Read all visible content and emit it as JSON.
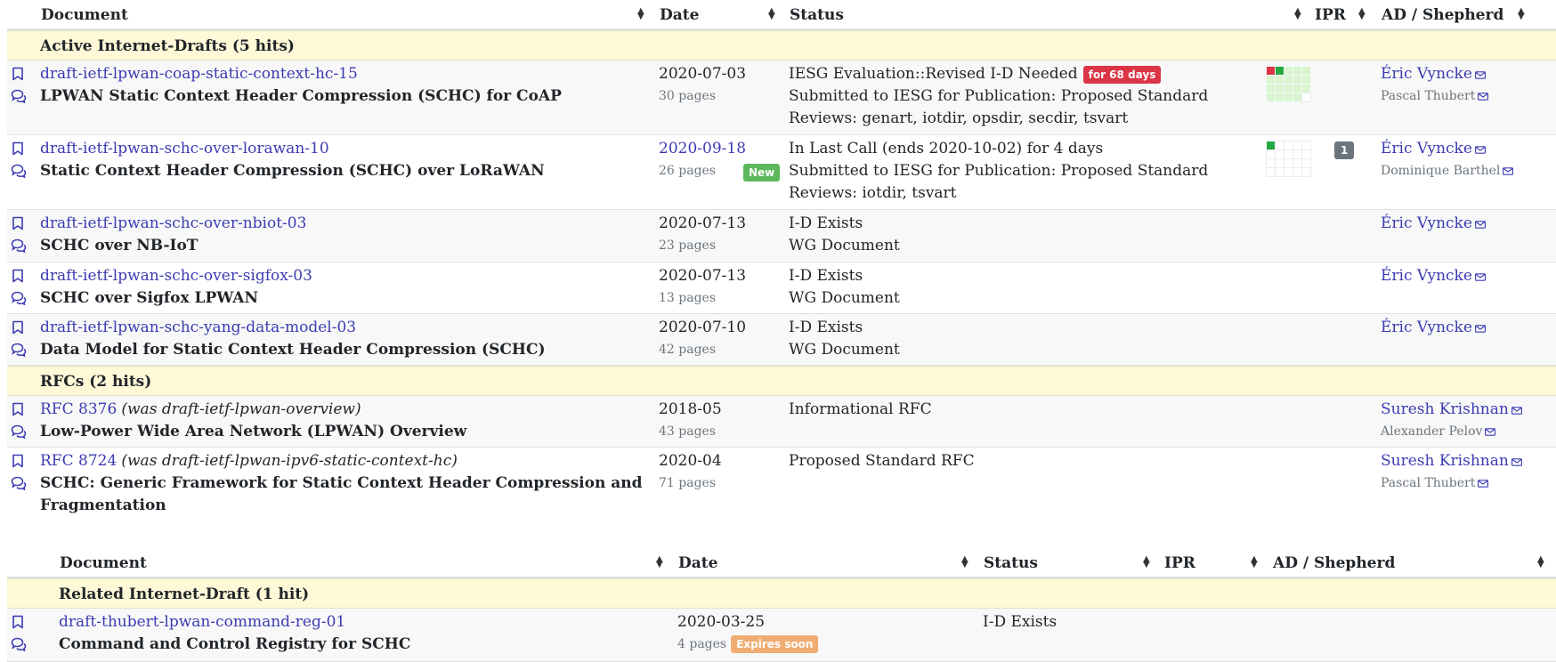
{
  "table1": {
    "headers": {
      "document": "Document",
      "date": "Date",
      "status": "Status",
      "ipr": "IPR",
      "ad": "AD / Shepherd"
    },
    "groups": {
      "active": "Active Internet-Drafts (5 hits)",
      "rfcs": "RFCs (2 hits)"
    },
    "rows": [
      {
        "doc": "draft-ietf-lpwan-coap-static-context-hc-15",
        "title": "LPWAN Static Context Header Compression (SCHC) for CoAP",
        "date": "2020-07-03",
        "pages": "30 pages",
        "status1": "IESG Evaluation::Revised I-D Needed",
        "badge": "for 68 days",
        "status2": "Submitted to IESG for Publication: Proposed Standard",
        "status3": "Reviews: genart, iotdir, opsdir, secdir, tsvart",
        "ad": "Éric Vyncke",
        "shepherd": "Pascal Thubert"
      },
      {
        "doc": "draft-ietf-lpwan-schc-over-lorawan-10",
        "title": "Static Context Header Compression (SCHC) over LoRaWAN",
        "date": "2020-09-18",
        "pages": "26 pages",
        "new_badge": "New",
        "status1": "In Last Call (ends 2020-10-02)  for 4 days",
        "status2": "Submitted to IESG for Publication: Proposed Standard",
        "status3": "Reviews: iotdir, tsvart",
        "ipr_count": "1",
        "ad": "Éric Vyncke",
        "shepherd": "Dominique Barthel"
      },
      {
        "doc": "draft-ietf-lpwan-schc-over-nbiot-03",
        "title": "SCHC over NB-IoT",
        "date": "2020-07-13",
        "pages": "23 pages",
        "status1": "I-D Exists",
        "status2": "WG Document",
        "ad": "Éric Vyncke"
      },
      {
        "doc": "draft-ietf-lpwan-schc-over-sigfox-03",
        "title": "SCHC over Sigfox LPWAN",
        "date": "2020-07-13",
        "pages": "13 pages",
        "status1": "I-D Exists",
        "status2": "WG Document",
        "ad": "Éric Vyncke"
      },
      {
        "doc": "draft-ietf-lpwan-schc-yang-data-model-03",
        "title": "Data Model for Static Context Header Compression (SCHC)",
        "date": "2020-07-10",
        "pages": "42 pages",
        "status1": "I-D Exists",
        "status2": "WG Document",
        "ad": "Éric Vyncke"
      },
      {
        "doc": "RFC 8376",
        "was": "(was draft-ietf-lpwan-overview)",
        "title": "Low-Power Wide Area Network (LPWAN) Overview",
        "date": "2018-05",
        "pages": "43 pages",
        "status1": "Informational RFC",
        "ad": "Suresh Krishnan",
        "shepherd": "Alexander Pelov"
      },
      {
        "doc": "RFC 8724",
        "was": "(was draft-ietf-lpwan-ipv6-static-context-hc)",
        "title1": "SCHC: Generic Framework for Static Context Header Compression and",
        "title2": "Fragmentation",
        "date": "2020-04",
        "pages": "71 pages",
        "status1": "Proposed Standard RFC",
        "ad": "Suresh Krishnan",
        "shepherd": "Pascal Thubert"
      }
    ]
  },
  "table2": {
    "headers": {
      "document": "Document",
      "date": "Date",
      "status": "Status",
      "ipr": "IPR",
      "ad": "AD / Shepherd"
    },
    "groups": {
      "related": "Related Internet-Draft (1 hit)"
    },
    "rows": [
      {
        "doc": "draft-thubert-lpwan-command-reg-01",
        "title": "Command and Control Registry for SCHC",
        "date": "2020-03-25",
        "pages": "4 pages",
        "badge": "Expires soon",
        "status1": "I-D Exists"
      }
    ]
  },
  "icons": {
    "bookmark": "bookmark-icon",
    "comments": "comments-icon",
    "mail": "envelope-icon",
    "sort": "sort-icon"
  },
  "colors": {
    "link": "#3b3bb3",
    "group_bg": "#fff9d8",
    "badge_red": "#dc3545",
    "badge_green": "#5cb85c",
    "badge_orange": "#f0ad73"
  }
}
